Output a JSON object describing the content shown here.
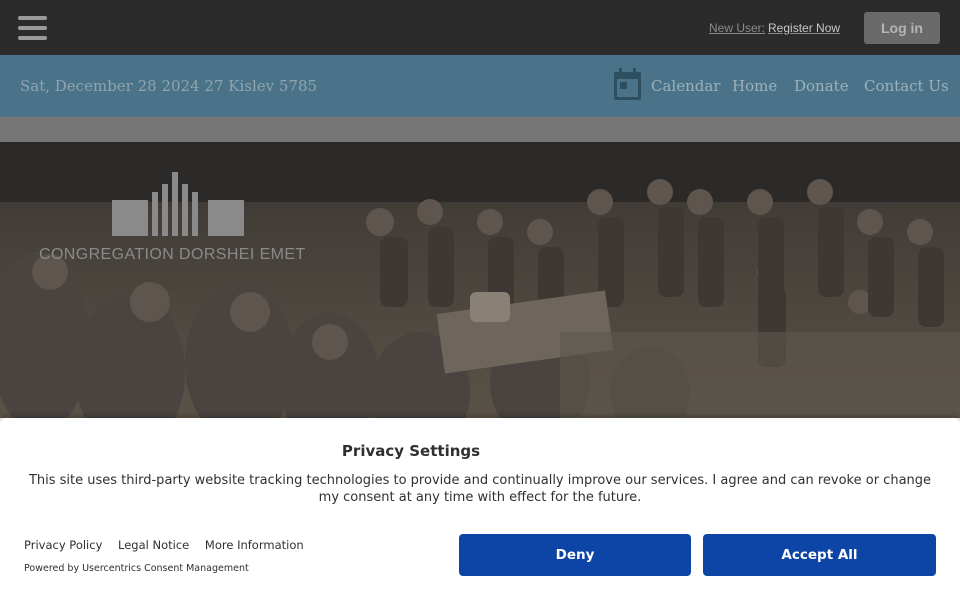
{
  "header": {
    "menu_icon": "hamburger-menu-icon",
    "new_user_label": "New User:",
    "register_label": "Register Now",
    "login_label": "Log in"
  },
  "nav": {
    "date": "Sat, December 28 2024 27 Kislev 5785",
    "calendar_icon": "calendar-icon",
    "links": [
      "Calendar",
      "Home",
      "Donate",
      "Contact Us"
    ]
  },
  "hero": {
    "logo_text": "CONGREGATION DORSHEI EMET",
    "logo_icon": "congregation-logo-mark"
  },
  "consent": {
    "title": "Privacy Settings",
    "body": "This site uses third-party website tracking technologies to provide and continually improve our services. I agree and can revoke or change my consent at any time with effect for the future.",
    "links": [
      "Privacy Policy",
      "Legal Notice",
      "More Information"
    ],
    "powered_by": "Powered by Usercentrics Consent Management",
    "deny_label": "Deny",
    "accept_label": "Accept All"
  },
  "colors": {
    "topbar": "#2b2b2b",
    "navbar": "#4a7389",
    "button_primary": "#0c45a6"
  }
}
